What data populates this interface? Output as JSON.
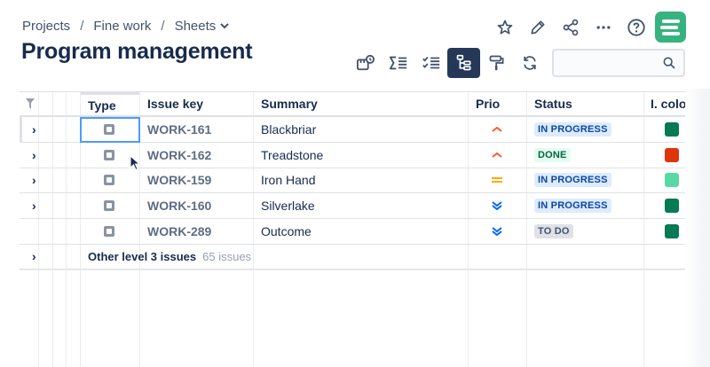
{
  "breadcrumb": {
    "project": "Projects",
    "folder": "Fine work",
    "sheet": "Sheets"
  },
  "page_title": "Program management",
  "top_actions": [
    "star-icon",
    "pencil-icon",
    "share-icon",
    "more-icon",
    "help-icon",
    "app-logo"
  ],
  "toolbar": [
    "ruler-icon",
    "sum-icon",
    "checklist-icon",
    "hierarchy-icon",
    "paint-roller-icon",
    "refresh-icon"
  ],
  "search": {
    "value": "",
    "placeholder": ""
  },
  "columns": {
    "type": "Type",
    "key": "Issue key",
    "summary": "Summary",
    "prio": "Prio",
    "status": "Status",
    "color": "I. colo"
  },
  "rows": [
    {
      "key": "WORK-161",
      "summary": "Blackbriar",
      "prio": "high",
      "status": "IN PROGRESS",
      "color": "#067a52",
      "expand": "›"
    },
    {
      "key": "WORK-162",
      "summary": "Treadstone",
      "prio": "high",
      "status": "DONE",
      "color": "#de350b",
      "expand": "›"
    },
    {
      "key": "WORK-159",
      "summary": "Iron Hand",
      "prio": "medium",
      "status": "IN PROGRESS",
      "color": "#57d9a3",
      "expand": "›"
    },
    {
      "key": "WORK-160",
      "summary": "Silverlake",
      "prio": "lowest",
      "status": "IN PROGRESS",
      "color": "#067a52",
      "expand": "›"
    },
    {
      "key": "WORK-289",
      "summary": "Outcome",
      "prio": "lowest",
      "status": "TO DO",
      "color": "#067a52",
      "expand": ""
    }
  ],
  "other_row": {
    "label": "Other level 3 issues",
    "count": "65 issues"
  },
  "status_colors": {
    "IN PROGRESS": {
      "bg": "#deebff",
      "fg": "#0747a6"
    },
    "DONE": {
      "bg": "#e3fcef",
      "fg": "#006644"
    },
    "TO DO": {
      "bg": "#dfe1e6",
      "fg": "#42526e"
    }
  }
}
